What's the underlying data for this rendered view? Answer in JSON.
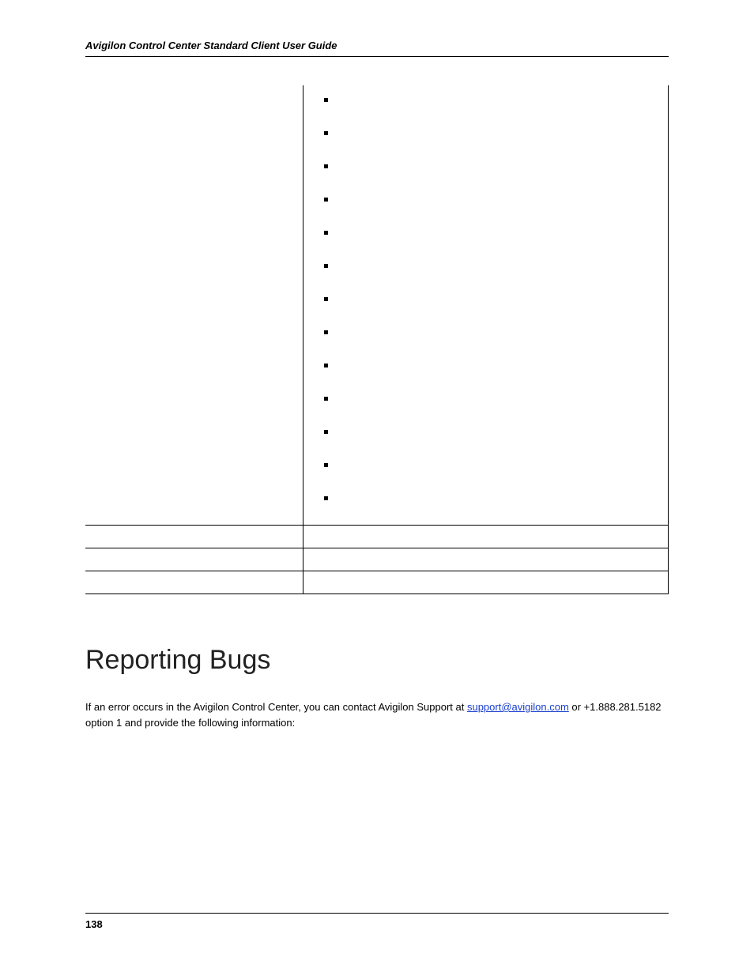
{
  "header": {
    "title": "Avigilon Control Center Standard Client User Guide"
  },
  "table": {
    "rows": [
      {
        "left": "",
        "bullets": [
          "",
          "",
          "",
          "",
          "",
          "",
          "",
          "",
          "",
          "",
          "",
          "",
          ""
        ]
      },
      {
        "left": "",
        "right": ""
      },
      {
        "left": "",
        "right": ""
      },
      {
        "left": "",
        "right": ""
      }
    ]
  },
  "section": {
    "heading": "Reporting Bugs",
    "para_before": "If an error occurs in the Avigilon Control Center, you can contact Avigilon Support at ",
    "link_text": "support@avigilon.com",
    "para_after": " or +1.888.281.5182 option 1 and provide the following information:"
  },
  "footer": {
    "page": "138"
  }
}
